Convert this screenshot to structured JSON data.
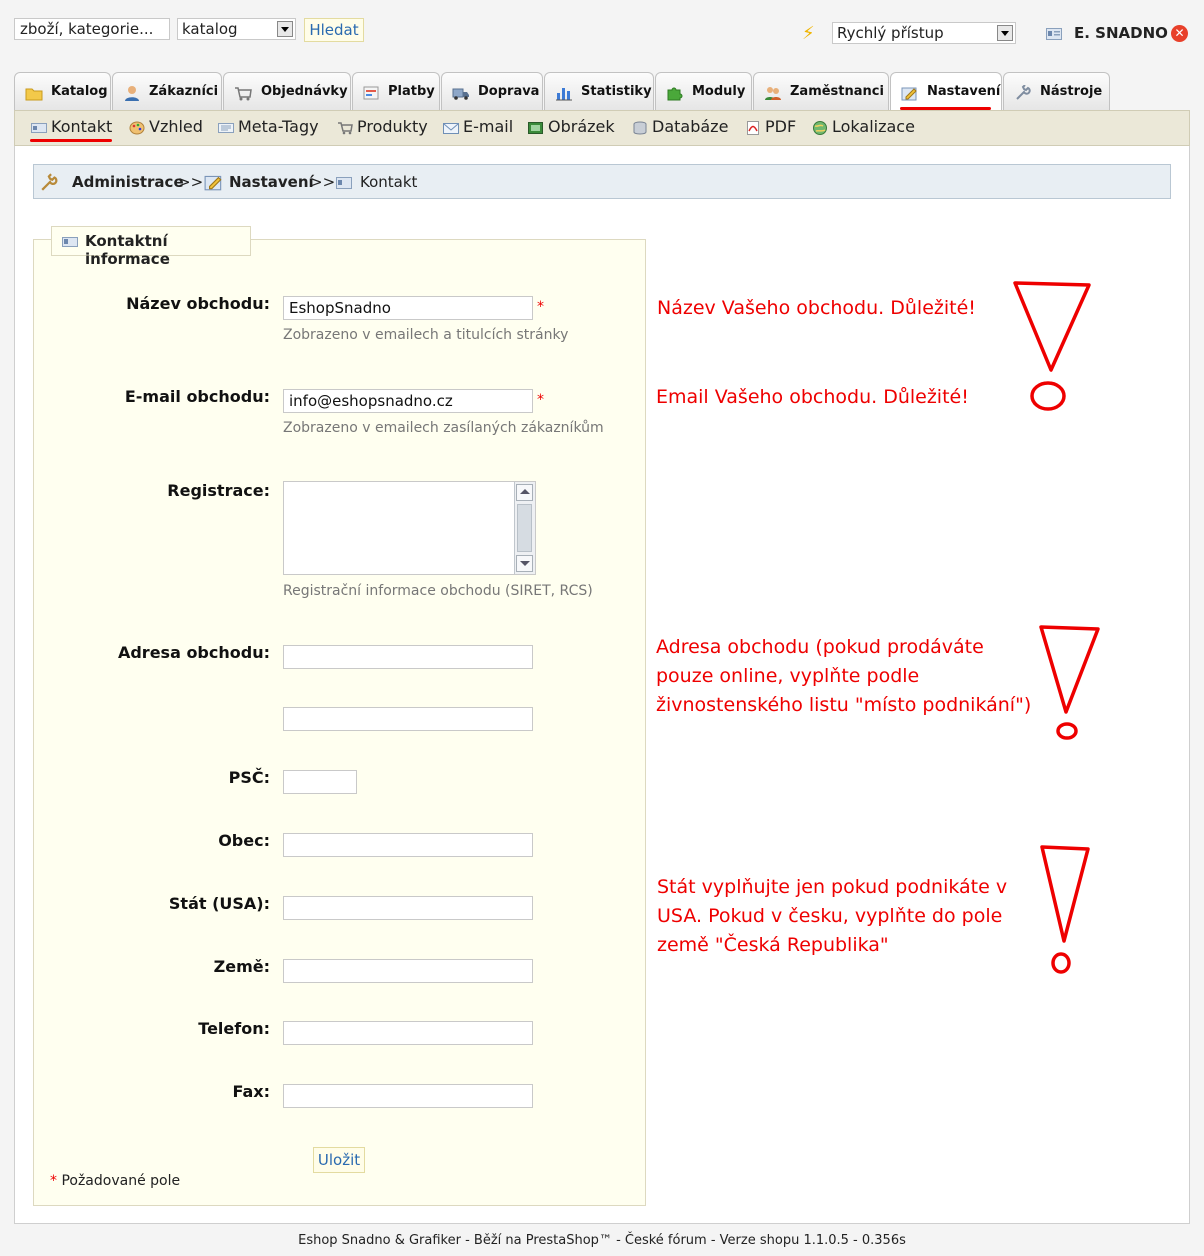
{
  "header": {
    "search_value": "zboží, kategorie...",
    "search_scope": "katalog",
    "search_button": "Hledat",
    "quick_access": "Rychlý přístup",
    "user_name": "E. SNADNO",
    "logout_symbol": "✕"
  },
  "tabs": [
    {
      "label": "Katalog",
      "icon": "folder-icon"
    },
    {
      "label": "Zákazníci",
      "icon": "customer-icon"
    },
    {
      "label": "Objednávky",
      "icon": "cart-icon"
    },
    {
      "label": "Platby",
      "icon": "payment-icon"
    },
    {
      "label": "Doprava",
      "icon": "truck-icon"
    },
    {
      "label": "Statistiky",
      "icon": "chart-icon"
    },
    {
      "label": "Moduly",
      "icon": "puzzle-icon"
    },
    {
      "label": "Zaměstnanci",
      "icon": "employees-icon"
    },
    {
      "label": "Nastavení",
      "icon": "settings-icon",
      "active": true
    },
    {
      "label": "Nástroje",
      "icon": "wrench-icon"
    }
  ],
  "subnav": [
    {
      "label": "Kontakt",
      "icon": "contact-card-icon",
      "active": true
    },
    {
      "label": "Vzhled",
      "icon": "palette-icon"
    },
    {
      "label": "Meta-Tagy",
      "icon": "meta-tags-icon"
    },
    {
      "label": "Produkty",
      "icon": "cart-icon"
    },
    {
      "label": "E-mail",
      "icon": "envelope-icon"
    },
    {
      "label": "Obrázek",
      "icon": "image-icon"
    },
    {
      "label": "Databáze",
      "icon": "database-icon"
    },
    {
      "label": "PDF",
      "icon": "pdf-icon"
    },
    {
      "label": "Lokalizace",
      "icon": "globe-icon"
    }
  ],
  "breadcrumb": {
    "root": "Administrace",
    "sep": ">>",
    "section": "Nastavení",
    "page": "Kontakt"
  },
  "form": {
    "legend": "Kontaktní informace",
    "shop_name": {
      "label": "Název obchodu:",
      "value": "EshopSnadno",
      "hint": "Zobrazeno v emailech a titulcích stránky"
    },
    "shop_email": {
      "label": "E-mail obchodu:",
      "value": "info@eshopsnadno.cz",
      "hint": "Zobrazeno v emailech zasílaných zákazníkům"
    },
    "registration": {
      "label": "Registrace:",
      "value": "",
      "hint": "Registrační informace obchodu (SIRET, RCS)"
    },
    "address": {
      "label": "Adresa obchodu:",
      "value1": "",
      "value2": ""
    },
    "zip": {
      "label": "PSČ:",
      "value": ""
    },
    "city": {
      "label": "Obec:",
      "value": ""
    },
    "state": {
      "label": "Stát (USA):",
      "value": ""
    },
    "country": {
      "label": "Země:",
      "value": ""
    },
    "phone": {
      "label": "Telefon:",
      "value": ""
    },
    "fax": {
      "label": "Fax:",
      "value": ""
    },
    "required_mark": "*",
    "save_button": "Uložit",
    "required_note": "Požadované pole"
  },
  "annotations": {
    "note1": "Název Vašeho obchodu. Důležité!",
    "note2": "Email Vašeho obchodu. Důležité!",
    "note3_lines": [
      "Adresa obchodu (pokud prodáváte",
      "pouze online, vyplňte podle",
      "živnostenského listu \"místo podnikání\")"
    ],
    "note4_lines": [
      "Stát vyplňujte jen pokud podnikáte v",
      "USA. Pokud v česku, vyplňte do pole",
      "země \"Česká Republika\""
    ],
    "accent_color": "#e00000"
  },
  "footer": {
    "text": "Eshop Snadno & Grafiker - Běží na PrestaShop™ - České fórum - Verze shopu 1.1.0.5 - 0.356s"
  }
}
